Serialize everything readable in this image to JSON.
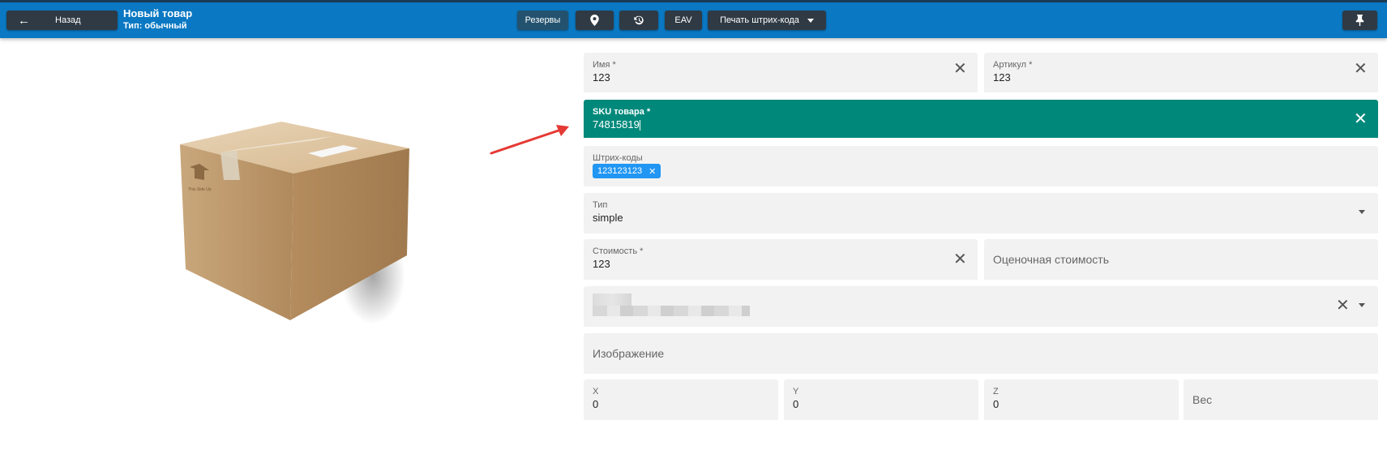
{
  "header": {
    "back_label": "Назад",
    "back_icon": "arrow-left-icon",
    "title": "Новый товар",
    "subtitle": "Тип: обычный",
    "reserves_label": "Резервы",
    "location_icon": "map-marker-icon",
    "history_icon": "history-icon",
    "eav_label": "EAV",
    "print_barcode_label": "Печать штрих-кода",
    "pin_icon": "pin-icon",
    "accent_color": "#0a78c3"
  },
  "form": {
    "name": {
      "label": "Имя *",
      "value": "123"
    },
    "article": {
      "label": "Артикул *",
      "value": "123"
    },
    "sku": {
      "label": "SKU товара *",
      "value": "74815819",
      "active_color": "#00897b"
    },
    "barcodes": {
      "label": "Штрих-коды",
      "chips": [
        "123123123"
      ]
    },
    "type": {
      "label": "Тип",
      "value": "simple"
    },
    "cost": {
      "label": "Стоимость *",
      "value": "123"
    },
    "estimated_cost": {
      "placeholder": "Оценочная стоимость"
    },
    "image": {
      "placeholder": "Изображение"
    },
    "x": {
      "label": "X",
      "value": "0"
    },
    "y": {
      "label": "Y",
      "value": "0"
    },
    "z": {
      "label": "Z",
      "value": "0"
    },
    "weight": {
      "placeholder": "Вес"
    }
  }
}
